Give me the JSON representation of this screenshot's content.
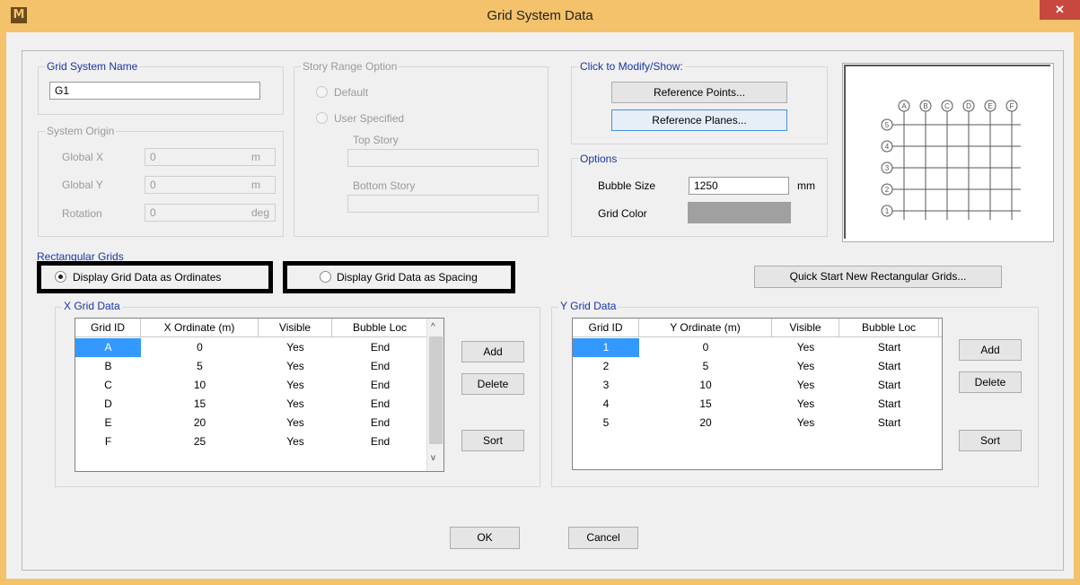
{
  "window": {
    "title": "Grid System Data",
    "icon": "app-icon",
    "icon_glyph": "M",
    "close_glyph": "✕"
  },
  "grid_system_name": {
    "label": "Grid System Name",
    "value": "G1"
  },
  "system_origin": {
    "label": "System Origin",
    "global_x": {
      "label": "Global X",
      "value": "0",
      "unit": "m"
    },
    "global_y": {
      "label": "Global Y",
      "value": "0",
      "unit": "m"
    },
    "rotation": {
      "label": "Rotation",
      "value": "0",
      "unit": "deg"
    }
  },
  "story_range": {
    "label": "Story Range Option",
    "default_label": "Default",
    "user_specified_label": "User Specified",
    "top_story_label": "Top Story",
    "top_story_value": "",
    "bottom_story_label": "Bottom Story",
    "bottom_story_value": ""
  },
  "modify_show": {
    "label": "Click to Modify/Show:",
    "reference_points": "Reference Points...",
    "reference_planes": "Reference Planes..."
  },
  "options": {
    "label": "Options",
    "bubble_size_label": "Bubble Size",
    "bubble_size_value": "1250",
    "bubble_size_unit": "mm",
    "grid_color_label": "Grid Color",
    "grid_color": "#a0a0a0"
  },
  "preview": {
    "x_bubbles": [
      "A",
      "B",
      "C",
      "D",
      "E",
      "F"
    ],
    "y_bubbles": [
      "5",
      "4",
      "3",
      "2",
      "1"
    ]
  },
  "rectangular_grids": {
    "label": "Rectangular Grids",
    "ordinates_label": "Display Grid Data as Ordinates",
    "ordinates_checked": true,
    "spacing_label": "Display Grid Data as Spacing",
    "spacing_checked": false,
    "quick_start": "Quick Start New Rectangular Grids..."
  },
  "x_grid": {
    "label": "X Grid Data",
    "columns": [
      "Grid ID",
      "X Ordinate (m)",
      "Visible",
      "Bubble Loc"
    ],
    "rows": [
      [
        "A",
        "0",
        "Yes",
        "End"
      ],
      [
        "B",
        "5",
        "Yes",
        "End"
      ],
      [
        "C",
        "10",
        "Yes",
        "End"
      ],
      [
        "D",
        "15",
        "Yes",
        "End"
      ],
      [
        "E",
        "20",
        "Yes",
        "End"
      ],
      [
        "F",
        "25",
        "Yes",
        "End"
      ]
    ],
    "add": "Add",
    "delete": "Delete",
    "sort": "Sort"
  },
  "y_grid": {
    "label": "Y Grid Data",
    "columns": [
      "Grid ID",
      "Y Ordinate (m)",
      "Visible",
      "Bubble Loc"
    ],
    "rows": [
      [
        "1",
        "0",
        "Yes",
        "Start"
      ],
      [
        "2",
        "5",
        "Yes",
        "Start"
      ],
      [
        "3",
        "10",
        "Yes",
        "Start"
      ],
      [
        "4",
        "15",
        "Yes",
        "Start"
      ],
      [
        "5",
        "20",
        "Yes",
        "Start"
      ]
    ],
    "add": "Add",
    "delete": "Delete",
    "sort": "Sort"
  },
  "footer": {
    "ok": "OK",
    "cancel": "Cancel"
  }
}
